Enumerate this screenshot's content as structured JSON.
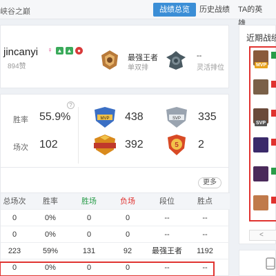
{
  "header": {
    "breadcrumb": "峡谷之巅",
    "tabs": [
      {
        "label": "战绩总览",
        "active": true
      },
      {
        "label": "历史战绩",
        "active": false
      },
      {
        "label": "TA的英雄",
        "active": false
      }
    ]
  },
  "profile": {
    "name": "jincanyi",
    "likes": "894赞",
    "gender_symbol": "♀",
    "ranks": [
      {
        "title": "最强王者",
        "subtitle": "单双排"
      },
      {
        "title": "--",
        "subtitle": "灵活排位"
      }
    ]
  },
  "stats": {
    "help": "?",
    "win_rate_label": "胜率",
    "win_rate_value": "55.9%",
    "games_label": "场次",
    "games_value": "102",
    "medals": [
      {
        "name": "mvp-medal",
        "count": "438",
        "color": "#3b6fc4"
      },
      {
        "name": "svp-medal",
        "count": "335",
        "color": "#9aa4b0"
      },
      {
        "name": "legendary-medal",
        "count": "392",
        "color": "#d98a1c"
      },
      {
        "name": "penta-kill-medal",
        "count": "2",
        "color": "#d84a25"
      }
    ]
  },
  "table": {
    "more_label": "更多",
    "headers": [
      "总场次",
      "胜率",
      "胜场",
      "负场",
      "段位",
      "胜点"
    ],
    "header_colors": [
      "#555555",
      "#555555",
      "#2a9d4a",
      "#e0322f",
      "#555555",
      "#555555"
    ],
    "rows": [
      [
        "0",
        "0%",
        "0",
        "0",
        "--",
        "--"
      ],
      [
        "0",
        "0%",
        "0",
        "0",
        "--",
        "--"
      ],
      [
        "223",
        "59%",
        "131",
        "92",
        "最强王者",
        "1192"
      ],
      [
        "0",
        "0%",
        "0",
        "0",
        "--",
        "--"
      ]
    ]
  },
  "recent": {
    "title": "近期战绩",
    "pager_prev": "<",
    "items": [
      {
        "hero_color": "#8a5a3a",
        "tag": "MVP",
        "tag_color": "#e8a21c",
        "mark_color": "#2a9d4a"
      },
      {
        "hero_color": "#7a6048",
        "tag": "",
        "tag_color": "",
        "mark_color": "#e0322f"
      },
      {
        "hero_color": "#6a4a3a",
        "tag": "SVP",
        "tag_color": "#555555",
        "mark_color": "#e0322f"
      },
      {
        "hero_color": "#3a2a6a",
        "tag": "",
        "tag_color": "",
        "mark_color": "#e0322f"
      },
      {
        "hero_color": "#4a2a5a",
        "tag": "",
        "tag_color": "",
        "mark_color": "#2a9d4a"
      },
      {
        "hero_color": "#c07a4a",
        "tag": "",
        "tag_color": "",
        "mark_color": "#e0322f"
      }
    ]
  },
  "colors": {
    "accent": "#3b8ed6",
    "highlight_border": "#e0322f",
    "win": "#2a9d4a",
    "loss": "#e0322f"
  }
}
